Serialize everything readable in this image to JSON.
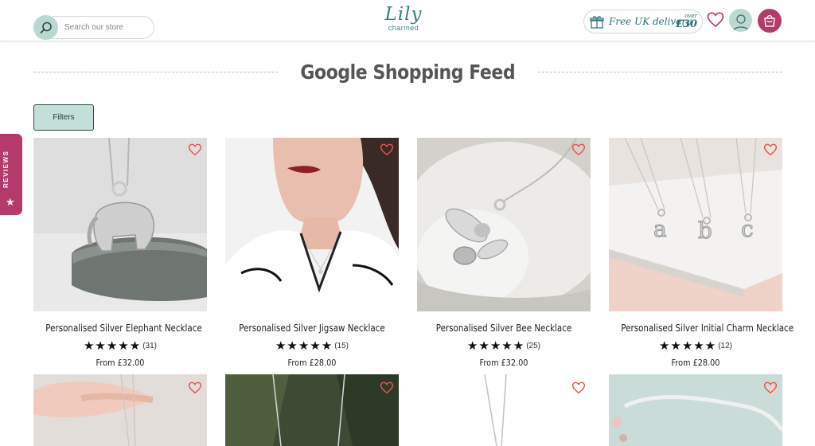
{
  "header": {
    "search_placeholder": "Search our store",
    "logo_main": "Lily",
    "logo_sub": "charmed",
    "delivery_text": "Free UK delivery",
    "delivery_over": "over",
    "delivery_amount": "£30"
  },
  "page": {
    "title": "Google Shopping Feed",
    "filters_label": "Filters",
    "reviews_tab_label": "REVIEWS"
  },
  "products": [
    {
      "name": "Personalised Silver Elephant Necklace",
      "rating_stars": "★★★★★",
      "reviews": "(31)",
      "price": "From £32.00"
    },
    {
      "name": "Personalised Silver Jigsaw Necklace",
      "rating_stars": "★★★★★",
      "reviews": "(15)",
      "price": "From £28.00"
    },
    {
      "name": "Personalised Silver Bee Necklace",
      "rating_stars": "★★★★★",
      "reviews": "(25)",
      "price": "From £32.00"
    },
    {
      "name": "Personalised Silver Initial Charm Necklace",
      "rating_stars": "★★★★★",
      "reviews": "(12)",
      "price": "From £28.00"
    }
  ],
  "colors": {
    "brand_teal": "#3d7f86",
    "brand_pink": "#b53a6c",
    "filters_bg": "#c3e0d8",
    "wishlist_heart": "#e0564f"
  },
  "icons": {
    "search": "search-icon",
    "gift": "gift-icon",
    "wishlist": "heart-icon",
    "account": "user-icon",
    "bag": "shopping-bag-icon",
    "reviews_star": "star-icon"
  }
}
